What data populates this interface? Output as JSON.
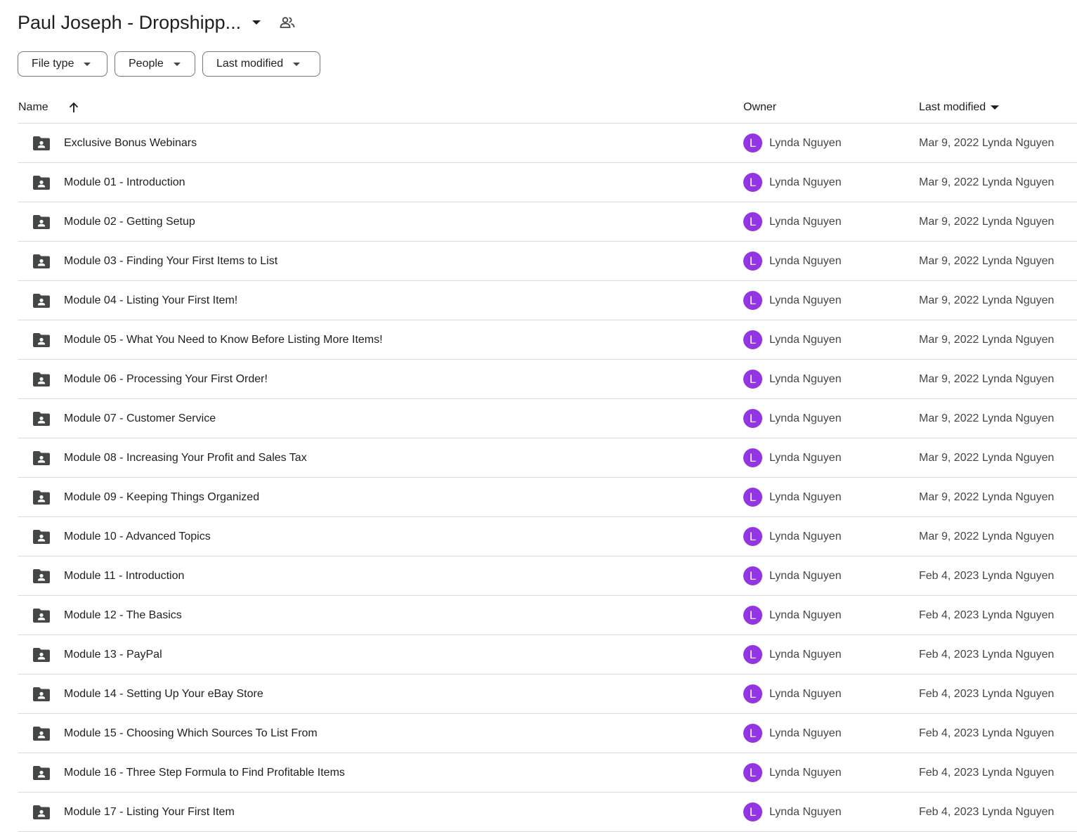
{
  "header": {
    "title": "Paul Joseph - Dropshipp...",
    "title_caret_icon": "arrow-drop-down-icon",
    "shared_icon": "people-icon"
  },
  "filters": [
    {
      "label": "File type"
    },
    {
      "label": "People"
    },
    {
      "label": "Last modified"
    }
  ],
  "table": {
    "columns": {
      "name": "Name",
      "owner": "Owner",
      "last_modified": "Last modified"
    },
    "sort_icon": "arrow-upward-icon",
    "rows": [
      {
        "name": "Exclusive Bonus Webinars",
        "owner_initial": "L",
        "owner": "Lynda Nguyen",
        "modified": "Mar 9, 2022 Lynda Nguyen"
      },
      {
        "name": "Module 01 - Introduction",
        "owner_initial": "L",
        "owner": "Lynda Nguyen",
        "modified": "Mar 9, 2022 Lynda Nguyen"
      },
      {
        "name": "Module 02 - Getting Setup",
        "owner_initial": "L",
        "owner": "Lynda Nguyen",
        "modified": "Mar 9, 2022 Lynda Nguyen"
      },
      {
        "name": "Module 03 - Finding Your First Items to List",
        "owner_initial": "L",
        "owner": "Lynda Nguyen",
        "modified": "Mar 9, 2022 Lynda Nguyen"
      },
      {
        "name": "Module 04 - Listing Your First Item!",
        "owner_initial": "L",
        "owner": "Lynda Nguyen",
        "modified": "Mar 9, 2022 Lynda Nguyen"
      },
      {
        "name": "Module 05 - What You Need to Know Before Listing More Items!",
        "owner_initial": "L",
        "owner": "Lynda Nguyen",
        "modified": "Mar 9, 2022 Lynda Nguyen"
      },
      {
        "name": "Module 06 - Processing Your First Order!",
        "owner_initial": "L",
        "owner": "Lynda Nguyen",
        "modified": "Mar 9, 2022 Lynda Nguyen"
      },
      {
        "name": "Module 07 - Customer Service",
        "owner_initial": "L",
        "owner": "Lynda Nguyen",
        "modified": "Mar 9, 2022 Lynda Nguyen"
      },
      {
        "name": "Module 08 - Increasing Your Profit and Sales Tax",
        "owner_initial": "L",
        "owner": "Lynda Nguyen",
        "modified": "Mar 9, 2022 Lynda Nguyen"
      },
      {
        "name": "Module 09 - Keeping Things Organized",
        "owner_initial": "L",
        "owner": "Lynda Nguyen",
        "modified": "Mar 9, 2022 Lynda Nguyen"
      },
      {
        "name": "Module 10 - Advanced Topics",
        "owner_initial": "L",
        "owner": "Lynda Nguyen",
        "modified": "Mar 9, 2022 Lynda Nguyen"
      },
      {
        "name": "Module 11 - Introduction",
        "owner_initial": "L",
        "owner": "Lynda Nguyen",
        "modified": "Feb 4, 2023 Lynda Nguyen"
      },
      {
        "name": "Module 12 - The Basics",
        "owner_initial": "L",
        "owner": "Lynda Nguyen",
        "modified": "Feb 4, 2023 Lynda Nguyen"
      },
      {
        "name": "Module 13 - PayPal",
        "owner_initial": "L",
        "owner": "Lynda Nguyen",
        "modified": "Feb 4, 2023 Lynda Nguyen"
      },
      {
        "name": "Module 14 - Setting Up Your eBay Store",
        "owner_initial": "L",
        "owner": "Lynda Nguyen",
        "modified": "Feb 4, 2023 Lynda Nguyen"
      },
      {
        "name": "Module 15 - Choosing Which Sources To List From",
        "owner_initial": "L",
        "owner": "Lynda Nguyen",
        "modified": "Feb 4, 2023 Lynda Nguyen"
      },
      {
        "name": "Module 16 - Three Step Formula to Find Profitable Items",
        "owner_initial": "L",
        "owner": "Lynda Nguyen",
        "modified": "Feb 4, 2023 Lynda Nguyen"
      },
      {
        "name": "Module 17 - Listing Your First Item",
        "owner_initial": "L",
        "owner": "Lynda Nguyen",
        "modified": "Feb 4, 2023 Lynda Nguyen"
      }
    ],
    "row_icon": "shared-folder-icon"
  },
  "colors": {
    "avatar": "#9334e6",
    "divider": "#dadce0",
    "text": "#1f1f1f",
    "secondary_text": "#444746"
  }
}
